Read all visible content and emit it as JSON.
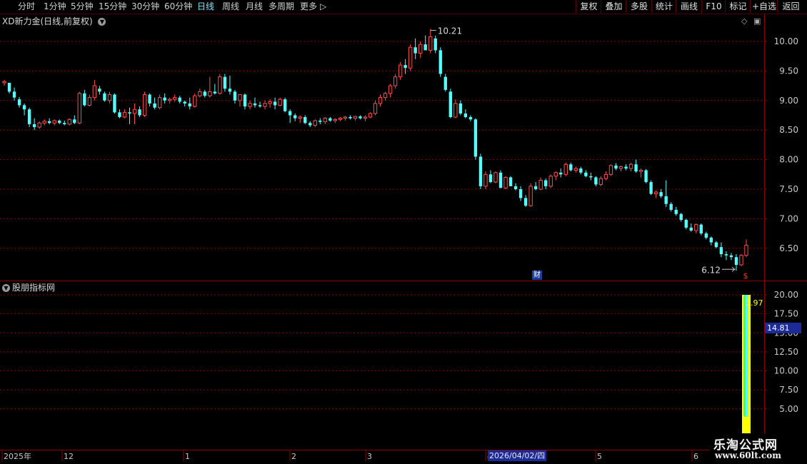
{
  "toolbar": {
    "periods": [
      "分时",
      "1分钟",
      "5分钟",
      "15分钟",
      "30分钟",
      "60分钟",
      "日线",
      "周线",
      "月线",
      "多周期",
      "更多"
    ],
    "active_period": "日线",
    "more_arrow": "▷",
    "right_buttons": [
      "复权",
      "叠加",
      "多股",
      "统计",
      "画线",
      "F10",
      "标记",
      "+自选",
      "返回"
    ]
  },
  "main_chart": {
    "title": "XD新力金(日线,前复权)",
    "high_label": "10.21",
    "low_label": "6.12",
    "cai_badge": "财",
    "price_ticks": [
      "10.00",
      "9.50",
      "9.00",
      "8.50",
      "8.00",
      "7.50",
      "7.00",
      "6.50"
    ],
    "colors": {
      "up": "#ff4d4d",
      "down": "#54ffff",
      "grid": "#8a0000",
      "axis": "#8a0000"
    }
  },
  "indicator": {
    "title": "股朋指标网",
    "value_label": "3.97",
    "marker_value": "14.81",
    "ticks": [
      "20.00",
      "17.50",
      "15.00",
      "12.50",
      "10.00",
      "7.50",
      "5.00"
    ]
  },
  "time_axis": {
    "labels": [
      "2025年",
      "12",
      "1",
      "2",
      "3",
      "4",
      "5",
      "6"
    ],
    "cursor_date": "2026/04/02/四"
  },
  "watermark": {
    "line1": "乐淘公式网",
    "line2": "www.60lt.com"
  },
  "chart_data": {
    "type": "candlestick",
    "title": "XD新力金(日线,前复权)",
    "y_range": [
      6.0,
      10.3
    ],
    "candles": [
      [
        9.3,
        9.35,
        9.25,
        9.32
      ],
      [
        9.3,
        9.3,
        9.12,
        9.15
      ],
      [
        9.15,
        9.22,
        9.0,
        9.05
      ],
      [
        9.02,
        9.06,
        8.88,
        8.92
      ],
      [
        8.92,
        8.95,
        8.75,
        8.85
      ],
      [
        8.85,
        8.88,
        8.55,
        8.6
      ],
      [
        8.6,
        8.7,
        8.5,
        8.55
      ],
      [
        8.55,
        8.65,
        8.52,
        8.62
      ],
      [
        8.62,
        8.68,
        8.58,
        8.65
      ],
      [
        8.65,
        8.7,
        8.6,
        8.62
      ],
      [
        8.62,
        8.68,
        8.58,
        8.66
      ],
      [
        8.66,
        8.68,
        8.6,
        8.62
      ],
      [
        8.62,
        8.66,
        8.58,
        8.6
      ],
      [
        8.6,
        8.7,
        8.58,
        8.68
      ],
      [
        8.68,
        8.75,
        8.6,
        8.62
      ],
      [
        8.62,
        9.15,
        8.6,
        9.12
      ],
      [
        9.12,
        9.18,
        8.9,
        8.92
      ],
      [
        8.92,
        9.1,
        8.9,
        9.05
      ],
      [
        9.05,
        9.35,
        9.0,
        9.25
      ],
      [
        9.2,
        9.25,
        9.1,
        9.15
      ],
      [
        9.12,
        9.15,
        8.98,
        9.0
      ],
      [
        9.0,
        9.15,
        8.95,
        9.1
      ],
      [
        9.1,
        9.12,
        8.78,
        8.8
      ],
      [
        8.8,
        8.85,
        8.7,
        8.72
      ],
      [
        8.72,
        8.85,
        8.7,
        8.8
      ],
      [
        8.8,
        8.88,
        8.6,
        8.78
      ],
      [
        8.78,
        8.95,
        8.6,
        8.85
      ],
      [
        8.85,
        8.9,
        8.72,
        8.75
      ],
      [
        8.75,
        9.15,
        8.72,
        9.1
      ],
      [
        9.1,
        9.12,
        8.9,
        8.95
      ],
      [
        8.95,
        9.05,
        8.85,
        8.88
      ],
      [
        8.88,
        9.1,
        8.85,
        9.05
      ],
      [
        9.05,
        9.12,
        8.95,
        9.0
      ],
      [
        9.0,
        9.05,
        8.95,
        9.02
      ],
      [
        9.02,
        9.1,
        8.98,
        9.05
      ],
      [
        9.05,
        9.08,
        8.95,
        8.98
      ],
      [
        8.98,
        9.0,
        8.9,
        8.95
      ],
      [
        8.95,
        9.05,
        8.85,
        8.9
      ],
      [
        8.9,
        9.12,
        8.88,
        9.08
      ],
      [
        9.08,
        9.2,
        9.05,
        9.15
      ],
      [
        9.15,
        9.18,
        9.05,
        9.08
      ],
      [
        9.08,
        9.4,
        9.05,
        9.15
      ],
      [
        9.15,
        9.28,
        9.1,
        9.12
      ],
      [
        9.12,
        9.45,
        9.1,
        9.4
      ],
      [
        9.4,
        9.45,
        9.15,
        9.2
      ],
      [
        9.2,
        9.42,
        9.1,
        9.15
      ],
      [
        9.15,
        9.18,
        8.95,
        9.0
      ],
      [
        9.0,
        9.1,
        8.9,
        9.1
      ],
      [
        9.1,
        9.12,
        8.85,
        8.9
      ],
      [
        8.9,
        9.0,
        8.85,
        8.95
      ],
      [
        8.95,
        9.05,
        8.88,
        8.92
      ],
      [
        8.92,
        8.98,
        8.88,
        8.9
      ],
      [
        8.9,
        9.0,
        8.85,
        8.95
      ],
      [
        8.95,
        9.02,
        8.88,
        8.98
      ],
      [
        8.98,
        9.05,
        8.85,
        8.92
      ],
      [
        8.92,
        9.05,
        8.9,
        9.02
      ],
      [
        9.02,
        9.05,
        8.8,
        8.82
      ],
      [
        8.82,
        8.85,
        8.62,
        8.75
      ],
      [
        8.75,
        8.78,
        8.65,
        8.7
      ],
      [
        8.7,
        8.75,
        8.62,
        8.72
      ],
      [
        8.72,
        8.75,
        8.6,
        8.62
      ],
      [
        8.62,
        8.65,
        8.55,
        8.58
      ],
      [
        8.58,
        8.68,
        8.55,
        8.66
      ],
      [
        8.66,
        8.7,
        8.6,
        8.64
      ],
      [
        8.64,
        8.72,
        8.6,
        8.7
      ],
      [
        8.7,
        8.72,
        8.64,
        8.66
      ],
      [
        8.66,
        8.7,
        8.62,
        8.68
      ],
      [
        8.68,
        8.72,
        8.65,
        8.7
      ],
      [
        8.7,
        8.74,
        8.66,
        8.72
      ],
      [
        8.72,
        8.75,
        8.68,
        8.7
      ],
      [
        8.7,
        8.74,
        8.66,
        8.73
      ],
      [
        8.73,
        8.75,
        8.68,
        8.7
      ],
      [
        8.7,
        8.75,
        8.65,
        8.72
      ],
      [
        8.72,
        8.8,
        8.7,
        8.78
      ],
      [
        8.78,
        9.0,
        8.75,
        8.95
      ],
      [
        8.95,
        9.1,
        8.9,
        9.05
      ],
      [
        9.05,
        9.15,
        9.0,
        9.12
      ],
      [
        9.12,
        9.28,
        9.05,
        9.25
      ],
      [
        9.25,
        9.45,
        9.2,
        9.4
      ],
      [
        9.4,
        9.65,
        9.35,
        9.6
      ],
      [
        9.6,
        9.7,
        9.45,
        9.55
      ],
      [
        9.55,
        9.95,
        9.5,
        9.9
      ],
      [
        9.9,
        10.05,
        9.7,
        9.8
      ],
      [
        9.8,
        10.0,
        9.72,
        9.95
      ],
      [
        9.95,
        10.1,
        9.85,
        9.85
      ],
      [
        9.85,
        10.21,
        9.8,
        10.08
      ],
      [
        10.05,
        10.1,
        9.8,
        9.85
      ],
      [
        9.85,
        9.9,
        9.4,
        9.45
      ],
      [
        9.4,
        9.45,
        9.15,
        9.18
      ],
      [
        9.15,
        9.2,
        8.7,
        8.72
      ],
      [
        8.72,
        9.02,
        8.7,
        8.95
      ],
      [
        8.95,
        9.0,
        8.75,
        8.78
      ],
      [
        8.78,
        8.85,
        8.7,
        8.72
      ],
      [
        8.72,
        8.75,
        8.65,
        8.68
      ],
      [
        8.68,
        8.7,
        8.0,
        8.05
      ],
      [
        8.05,
        8.1,
        7.5,
        7.55
      ],
      [
        7.55,
        7.8,
        7.5,
        7.75
      ],
      [
        7.75,
        7.82,
        7.6,
        7.62
      ],
      [
        7.62,
        7.8,
        7.6,
        7.78
      ],
      [
        7.78,
        7.82,
        7.55,
        7.52
      ],
      [
        7.52,
        7.72,
        7.5,
        7.7
      ],
      [
        7.7,
        7.72,
        7.55,
        7.55
      ],
      [
        7.55,
        7.6,
        7.48,
        7.5
      ],
      [
        7.5,
        7.55,
        7.3,
        7.35
      ],
      [
        7.35,
        7.4,
        7.2,
        7.22
      ],
      [
        7.22,
        7.6,
        7.2,
        7.55
      ],
      [
        7.55,
        7.62,
        7.48,
        7.5
      ],
      [
        7.5,
        7.7,
        7.48,
        7.65
      ],
      [
        7.65,
        7.68,
        7.5,
        7.55
      ],
      [
        7.55,
        7.75,
        7.52,
        7.72
      ],
      [
        7.72,
        7.8,
        7.65,
        7.78
      ],
      [
        7.78,
        7.85,
        7.7,
        7.75
      ],
      [
        7.75,
        7.95,
        7.72,
        7.92
      ],
      [
        7.92,
        7.95,
        7.8,
        7.82
      ],
      [
        7.82,
        7.88,
        7.78,
        7.85
      ],
      [
        7.85,
        7.88,
        7.75,
        7.78
      ],
      [
        7.78,
        7.82,
        7.7,
        7.72
      ],
      [
        7.72,
        7.78,
        7.65,
        7.7
      ],
      [
        7.7,
        7.72,
        7.55,
        7.58
      ],
      [
        7.58,
        7.72,
        7.55,
        7.68
      ],
      [
        7.68,
        7.8,
        7.65,
        7.75
      ],
      [
        7.75,
        7.92,
        7.72,
        7.9
      ],
      [
        7.9,
        7.94,
        7.82,
        7.85
      ],
      [
        7.85,
        7.9,
        7.8,
        7.88
      ],
      [
        7.88,
        7.92,
        7.82,
        7.85
      ],
      [
        7.85,
        7.95,
        7.8,
        7.92
      ],
      [
        7.92,
        8.0,
        7.78,
        7.8
      ],
      [
        7.8,
        7.85,
        7.7,
        7.82
      ],
      [
        7.82,
        7.84,
        7.6,
        7.62
      ],
      [
        7.62,
        7.65,
        7.4,
        7.42
      ],
      [
        7.42,
        7.48,
        7.35,
        7.45
      ],
      [
        7.45,
        7.5,
        7.35,
        7.38
      ],
      [
        7.38,
        7.65,
        7.2,
        7.25
      ],
      [
        7.25,
        7.28,
        7.12,
        7.15
      ],
      [
        7.15,
        7.2,
        7.05,
        7.08
      ],
      [
        7.08,
        7.1,
        6.95,
        6.98
      ],
      [
        6.98,
        7.0,
        6.82,
        6.85
      ],
      [
        6.85,
        6.92,
        6.78,
        6.8
      ],
      [
        6.8,
        6.92,
        6.75,
        6.9
      ],
      [
        6.9,
        6.92,
        6.72,
        6.75
      ],
      [
        6.75,
        6.78,
        6.65,
        6.68
      ],
      [
        6.68,
        6.7,
        6.55,
        6.6
      ],
      [
        6.6,
        6.62,
        6.5,
        6.52
      ],
      [
        6.52,
        6.6,
        6.35,
        6.4
      ],
      [
        6.4,
        6.45,
        6.3,
        6.38
      ],
      [
        6.38,
        6.42,
        6.3,
        6.35
      ],
      [
        6.35,
        6.4,
        6.12,
        6.22
      ],
      [
        6.22,
        6.4,
        6.2,
        6.38
      ],
      [
        6.38,
        6.65,
        6.35,
        6.55
      ]
    ],
    "indicator_value": 3.97,
    "indicator_marker": 14.81
  }
}
